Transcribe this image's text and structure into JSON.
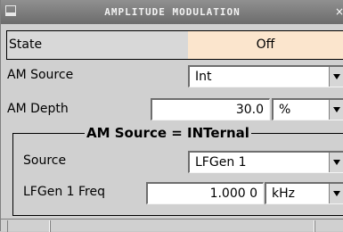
{
  "window": {
    "title": "AMPLITUDE MODULATION",
    "close_glyph": "×"
  },
  "state": {
    "label": "State",
    "value": "Off",
    "value_color": "#fbe5cd"
  },
  "am_source": {
    "label": "AM Source",
    "value": "Int"
  },
  "am_depth": {
    "label": "AM Depth",
    "value": "30.0",
    "unit": "%"
  },
  "group": {
    "title": "AM Source = INTernal",
    "source": {
      "label": "Source",
      "value": "LFGen 1"
    },
    "lfgen_freq": {
      "label": "LFGen 1 Freq",
      "value": "1.000 0",
      "unit": "kHz"
    }
  }
}
